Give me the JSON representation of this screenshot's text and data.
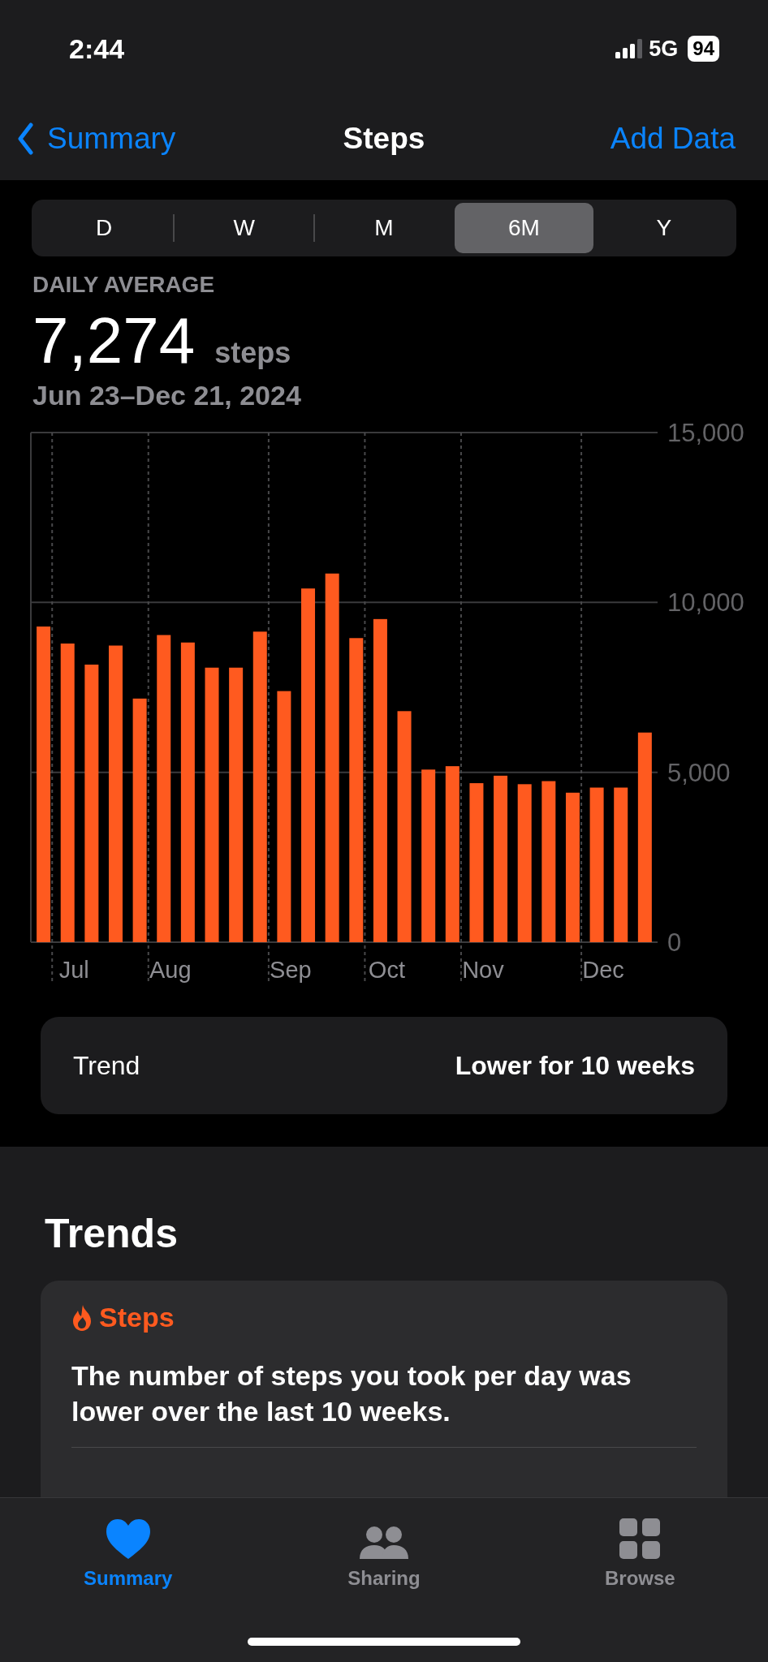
{
  "status_bar": {
    "time": "2:44",
    "network": "5G",
    "battery": "94"
  },
  "nav": {
    "back": "Summary",
    "title": "Steps",
    "action": "Add Data"
  },
  "ranges": [
    {
      "label": "D",
      "selected": false
    },
    {
      "label": "W",
      "selected": false
    },
    {
      "label": "M",
      "selected": false
    },
    {
      "label": "6M",
      "selected": true
    },
    {
      "label": "Y",
      "selected": false
    }
  ],
  "summary": {
    "label": "DAILY AVERAGE",
    "value": "7,274",
    "unit": "steps",
    "date_range": "Jun 23–Dec 21, 2024"
  },
  "chart_data": {
    "type": "bar",
    "categories": [
      null,
      "Jul",
      null,
      null,
      null,
      "Aug",
      null,
      null,
      null,
      null,
      "Sep",
      null,
      null,
      null,
      "Oct",
      null,
      null,
      null,
      "Nov",
      null,
      null,
      null,
      null,
      "Dec",
      null,
      null
    ],
    "series": [
      {
        "color": "#ff5a1f",
        "values": [
          9290,
          8790,
          8170,
          8730,
          7170,
          9040,
          8820,
          8080,
          8080,
          9140,
          7390,
          10410,
          10850,
          8950,
          9510,
          6800,
          5080,
          5180,
          4680,
          4900,
          4650,
          4740,
          4400,
          4550,
          4550,
          6170
        ]
      }
    ],
    "ylim": [
      0,
      15000
    ],
    "grid": true,
    "yticks": [
      {
        "value": 0,
        "label": "0"
      },
      {
        "value": 5000,
        "label": "5,000"
      },
      {
        "value": 10000,
        "label": "10,000"
      },
      {
        "value": 15000,
        "label": "15,000"
      }
    ]
  },
  "trend_row": {
    "label": "Trend",
    "value": "Lower for 10 weeks"
  },
  "trends": {
    "heading": "Trends",
    "card": {
      "title": "Steps",
      "text": "The number of steps you took per day was lower over the last 10 weeks."
    }
  },
  "tab_bar": [
    {
      "label": "Summary",
      "selected": true
    },
    {
      "label": "Sharing",
      "selected": false
    },
    {
      "label": "Browse",
      "selected": false
    }
  ]
}
